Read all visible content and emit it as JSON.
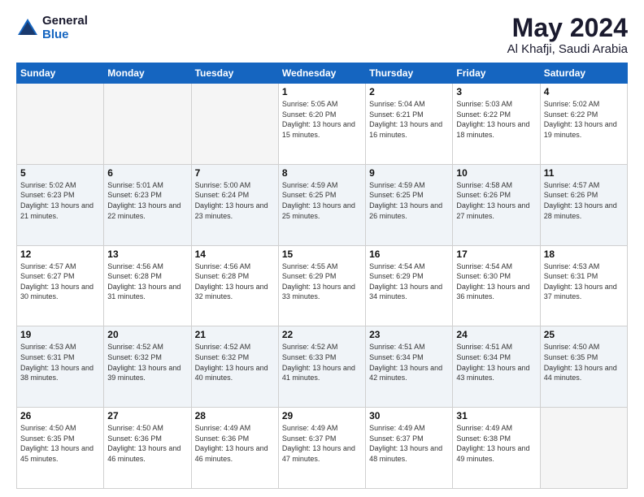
{
  "header": {
    "logo_general": "General",
    "logo_blue": "Blue",
    "title": "May 2024",
    "location": "Al Khafji, Saudi Arabia"
  },
  "days_of_week": [
    "Sunday",
    "Monday",
    "Tuesday",
    "Wednesday",
    "Thursday",
    "Friday",
    "Saturday"
  ],
  "weeks": [
    [
      {
        "date": "",
        "info": ""
      },
      {
        "date": "",
        "info": ""
      },
      {
        "date": "",
        "info": ""
      },
      {
        "date": "1",
        "info": "Sunrise: 5:05 AM\nSunset: 6:20 PM\nDaylight: 13 hours and 15 minutes."
      },
      {
        "date": "2",
        "info": "Sunrise: 5:04 AM\nSunset: 6:21 PM\nDaylight: 13 hours and 16 minutes."
      },
      {
        "date": "3",
        "info": "Sunrise: 5:03 AM\nSunset: 6:22 PM\nDaylight: 13 hours and 18 minutes."
      },
      {
        "date": "4",
        "info": "Sunrise: 5:02 AM\nSunset: 6:22 PM\nDaylight: 13 hours and 19 minutes."
      }
    ],
    [
      {
        "date": "5",
        "info": "Sunrise: 5:02 AM\nSunset: 6:23 PM\nDaylight: 13 hours and 21 minutes."
      },
      {
        "date": "6",
        "info": "Sunrise: 5:01 AM\nSunset: 6:23 PM\nDaylight: 13 hours and 22 minutes."
      },
      {
        "date": "7",
        "info": "Sunrise: 5:00 AM\nSunset: 6:24 PM\nDaylight: 13 hours and 23 minutes."
      },
      {
        "date": "8",
        "info": "Sunrise: 4:59 AM\nSunset: 6:25 PM\nDaylight: 13 hours and 25 minutes."
      },
      {
        "date": "9",
        "info": "Sunrise: 4:59 AM\nSunset: 6:25 PM\nDaylight: 13 hours and 26 minutes."
      },
      {
        "date": "10",
        "info": "Sunrise: 4:58 AM\nSunset: 6:26 PM\nDaylight: 13 hours and 27 minutes."
      },
      {
        "date": "11",
        "info": "Sunrise: 4:57 AM\nSunset: 6:26 PM\nDaylight: 13 hours and 28 minutes."
      }
    ],
    [
      {
        "date": "12",
        "info": "Sunrise: 4:57 AM\nSunset: 6:27 PM\nDaylight: 13 hours and 30 minutes."
      },
      {
        "date": "13",
        "info": "Sunrise: 4:56 AM\nSunset: 6:28 PM\nDaylight: 13 hours and 31 minutes."
      },
      {
        "date": "14",
        "info": "Sunrise: 4:56 AM\nSunset: 6:28 PM\nDaylight: 13 hours and 32 minutes."
      },
      {
        "date": "15",
        "info": "Sunrise: 4:55 AM\nSunset: 6:29 PM\nDaylight: 13 hours and 33 minutes."
      },
      {
        "date": "16",
        "info": "Sunrise: 4:54 AM\nSunset: 6:29 PM\nDaylight: 13 hours and 34 minutes."
      },
      {
        "date": "17",
        "info": "Sunrise: 4:54 AM\nSunset: 6:30 PM\nDaylight: 13 hours and 36 minutes."
      },
      {
        "date": "18",
        "info": "Sunrise: 4:53 AM\nSunset: 6:31 PM\nDaylight: 13 hours and 37 minutes."
      }
    ],
    [
      {
        "date": "19",
        "info": "Sunrise: 4:53 AM\nSunset: 6:31 PM\nDaylight: 13 hours and 38 minutes."
      },
      {
        "date": "20",
        "info": "Sunrise: 4:52 AM\nSunset: 6:32 PM\nDaylight: 13 hours and 39 minutes."
      },
      {
        "date": "21",
        "info": "Sunrise: 4:52 AM\nSunset: 6:32 PM\nDaylight: 13 hours and 40 minutes."
      },
      {
        "date": "22",
        "info": "Sunrise: 4:52 AM\nSunset: 6:33 PM\nDaylight: 13 hours and 41 minutes."
      },
      {
        "date": "23",
        "info": "Sunrise: 4:51 AM\nSunset: 6:34 PM\nDaylight: 13 hours and 42 minutes."
      },
      {
        "date": "24",
        "info": "Sunrise: 4:51 AM\nSunset: 6:34 PM\nDaylight: 13 hours and 43 minutes."
      },
      {
        "date": "25",
        "info": "Sunrise: 4:50 AM\nSunset: 6:35 PM\nDaylight: 13 hours and 44 minutes."
      }
    ],
    [
      {
        "date": "26",
        "info": "Sunrise: 4:50 AM\nSunset: 6:35 PM\nDaylight: 13 hours and 45 minutes."
      },
      {
        "date": "27",
        "info": "Sunrise: 4:50 AM\nSunset: 6:36 PM\nDaylight: 13 hours and 46 minutes."
      },
      {
        "date": "28",
        "info": "Sunrise: 4:49 AM\nSunset: 6:36 PM\nDaylight: 13 hours and 46 minutes."
      },
      {
        "date": "29",
        "info": "Sunrise: 4:49 AM\nSunset: 6:37 PM\nDaylight: 13 hours and 47 minutes."
      },
      {
        "date": "30",
        "info": "Sunrise: 4:49 AM\nSunset: 6:37 PM\nDaylight: 13 hours and 48 minutes."
      },
      {
        "date": "31",
        "info": "Sunrise: 4:49 AM\nSunset: 6:38 PM\nDaylight: 13 hours and 49 minutes."
      },
      {
        "date": "",
        "info": ""
      }
    ]
  ]
}
